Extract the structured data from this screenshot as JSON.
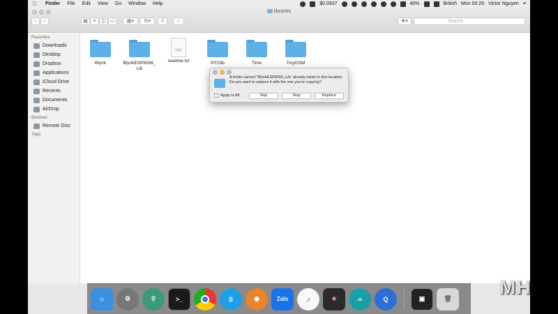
{
  "menubar": {
    "app": "Finder",
    "items": [
      "File",
      "Edit",
      "View",
      "Go",
      "Window",
      "Help"
    ],
    "price": "$0.0937",
    "battery": "40%",
    "input_source": "British",
    "clock": "Mon 00:29",
    "user": "Victor Nguyen"
  },
  "window": {
    "title": "libraries",
    "search_placeholder": "Search"
  },
  "sidebar": {
    "favorites_header": "Favorites",
    "favorites": [
      "Downloads",
      "Desktop",
      "Dropbox",
      "Applications",
      "iCloud Drive",
      "Recents",
      "Documents",
      "AirDrop"
    ],
    "devices_header": "Devices",
    "devices": [
      "Remote Disc"
    ],
    "tags_header": "Tags"
  },
  "files": [
    {
      "name": "Blynk",
      "kind": "folder"
    },
    {
      "name": "BlynkESP8266_Lib",
      "kind": "folder"
    },
    {
      "name": "readme.txt",
      "kind": "document",
      "badge": "TXT"
    },
    {
      "name": "RTClib",
      "kind": "folder"
    },
    {
      "name": "Time",
      "kind": "folder"
    },
    {
      "name": "TinyGSM",
      "kind": "folder"
    }
  ],
  "dialog": {
    "message": "A folder named “BlynkESP8266_Lib” already exists in this location. Do you want to replace it with the one you’re copying?",
    "apply_to_all": "Apply to All",
    "skip": "Skip",
    "stop": "Stop",
    "replace": "Replace"
  },
  "dock": {
    "icons": [
      "finder-icon",
      "system-preferences-icon",
      "keychain-icon",
      "terminal-icon",
      "chrome-icon",
      "skype-icon",
      "blender-icon",
      "zalo-icon",
      "itunes-icon",
      "final-cut-pro-icon",
      "arduino-icon",
      "quicktime-icon",
      "screen-recorder-icon",
      "trash-icon"
    ],
    "zalo_label": "Zalo"
  },
  "watermark": "MHD"
}
